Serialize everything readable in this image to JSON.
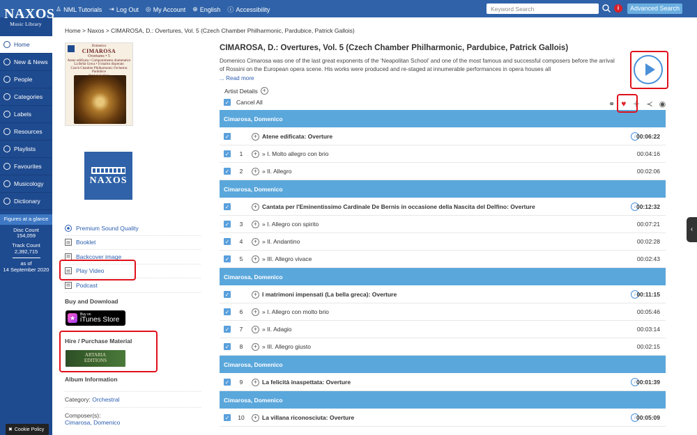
{
  "logo": {
    "line1": "NAXOS",
    "line2": "Music Library"
  },
  "topnav": [
    {
      "icon": "person-icon",
      "glyph": "♙",
      "label": "NML Tutorials"
    },
    {
      "icon": "logout-icon",
      "glyph": "⇥",
      "label": "Log Out"
    },
    {
      "icon": "account-icon",
      "glyph": "◎",
      "label": "My Account"
    },
    {
      "icon": "globe-icon",
      "glyph": "⊕",
      "label": "English"
    },
    {
      "icon": "accessibility-icon",
      "glyph": "ⓘ",
      "label": "Accessibility"
    }
  ],
  "search": {
    "placeholder": "Keyword Search",
    "advanced_label": "Advanced Search"
  },
  "sidebar": {
    "items": [
      {
        "label": "Home",
        "icon": "home-icon"
      },
      {
        "label": "New & News",
        "icon": "news-icon"
      },
      {
        "label": "People",
        "icon": "people-icon"
      },
      {
        "label": "Categories",
        "icon": "categories-icon"
      },
      {
        "label": "Labels",
        "icon": "labels-icon"
      },
      {
        "label": "Resources",
        "icon": "resources-icon"
      },
      {
        "label": "Playlists",
        "icon": "playlists-icon"
      },
      {
        "label": "Favourites",
        "icon": "heart-icon"
      },
      {
        "label": "Musicology",
        "icon": "musicology-icon"
      },
      {
        "label": "Dictionary",
        "icon": "dictionary-icon"
      }
    ],
    "figures": {
      "title": "Figures at a glance",
      "disc_label": "Disc Count",
      "disc_count": "154,059",
      "track_label": "Track Count",
      "track_count": "2,392,715",
      "as_of_label": "as of",
      "as_of_date": "14 September 2020"
    },
    "cookie_label": "Cookie Policy"
  },
  "breadcrumb": "Home > Naxos > CIMAROSA, D.: Overtures, Vol. 5 (Czech Chamber Philharmonic, Pardubice, Patrick Gallois)",
  "cover": {
    "composer_small": "Domenico",
    "composer": "CIMAROSA",
    "subtitle": "Overtures • 5",
    "works1": "Atene edificata • Componimento drammatico",
    "works2": "La Bella Greca • Il marito disperato",
    "orchestra": "Czech Chamber Philharmonic Orchestra Pardubice",
    "conductor": "Patrick Gallois"
  },
  "label_logo": "NAXOS",
  "left_links": [
    {
      "label": "Premium Sound Quality",
      "icon": "radio-icon"
    },
    {
      "label": "Booklet",
      "icon": "document-icon"
    },
    {
      "label": "Backcover image",
      "icon": "image-icon"
    },
    {
      "label": "Play Video",
      "icon": "video-icon"
    },
    {
      "label": "Podcast",
      "icon": "podcast-icon"
    }
  ],
  "buy_download_title": "Buy and Download",
  "itunes": {
    "small": "Buy on",
    "big": "iTunes Store"
  },
  "hire_title": "Hire / Purchase Material",
  "artaria": {
    "line1": "ARTARIA",
    "line2": "EDITIONS"
  },
  "album_info": {
    "title": "Album Information",
    "category_label": "Category:",
    "category": "Orchestral",
    "composer_label": "Composer(s):",
    "composer": "Cimarosa, Domenico"
  },
  "album": {
    "title": "CIMAROSA, D.: Overtures, Vol. 5 (Czech Chamber Philharmonic, Pardubice, Patrick Gallois)",
    "description": "Domenico Cimarosa was one of the last great exponents of the ‘Neapolitan School’ and one of the most famous and successful composers before the arrival of Rossini on the European opera scene. His works were produced and re-staged at innumerable performances in opera houses all",
    "read_more": "... Read more",
    "artist_details": "Artist Details",
    "cancel_all": "Cancel All"
  },
  "tracks": [
    {
      "type": "group",
      "label": "Cimarosa, Domenico"
    },
    {
      "type": "work",
      "num": "",
      "title": "Atene edificata: Overture",
      "dur": "00:06:22"
    },
    {
      "type": "track",
      "num": "1",
      "title": "» I. Molto allegro con brio",
      "dur": "00:04:16"
    },
    {
      "type": "track",
      "num": "2",
      "title": "» II. Allegro",
      "dur": "00:02:06"
    },
    {
      "type": "group",
      "label": "Cimarosa, Domenico"
    },
    {
      "type": "work",
      "num": "",
      "title": "Cantata per l'Eminentissimo Cardinale De Bernis in occasione della Nascita del Delfino: Overture",
      "dur": "00:12:32"
    },
    {
      "type": "track",
      "num": "3",
      "title": "» I. Allegro con spirito",
      "dur": "00:07:21"
    },
    {
      "type": "track",
      "num": "4",
      "title": "» II. Andantino",
      "dur": "00:02:28"
    },
    {
      "type": "track",
      "num": "5",
      "title": "» III. Allegro vivace",
      "dur": "00:02:43"
    },
    {
      "type": "group",
      "label": "Cimarosa, Domenico"
    },
    {
      "type": "work",
      "num": "",
      "title": "I matrimoni impensati (La bella greca): Overture",
      "dur": "00:11:15"
    },
    {
      "type": "track",
      "num": "6",
      "title": "» I. Allegro con molto brio",
      "dur": "00:05:46"
    },
    {
      "type": "track",
      "num": "7",
      "title": "» II. Adagio",
      "dur": "00:03:14"
    },
    {
      "type": "track",
      "num": "8",
      "title": "» III. Allegro giusto",
      "dur": "00:02:15"
    },
    {
      "type": "group",
      "label": "Cimarosa, Domenico"
    },
    {
      "type": "work",
      "num": "9",
      "title": "La felicità inaspettata: Overture",
      "dur": "00:01:39"
    },
    {
      "type": "group",
      "label": "Cimarosa, Domenico"
    },
    {
      "type": "work",
      "num": "10",
      "title": "La villana riconosciuta: Overture",
      "dur": "00:05:09"
    }
  ],
  "colors": {
    "brand": "#2f62a8",
    "sidebar": "#1e4a8f",
    "group_bar": "#5aa7dc",
    "highlight": "#e0101a"
  }
}
